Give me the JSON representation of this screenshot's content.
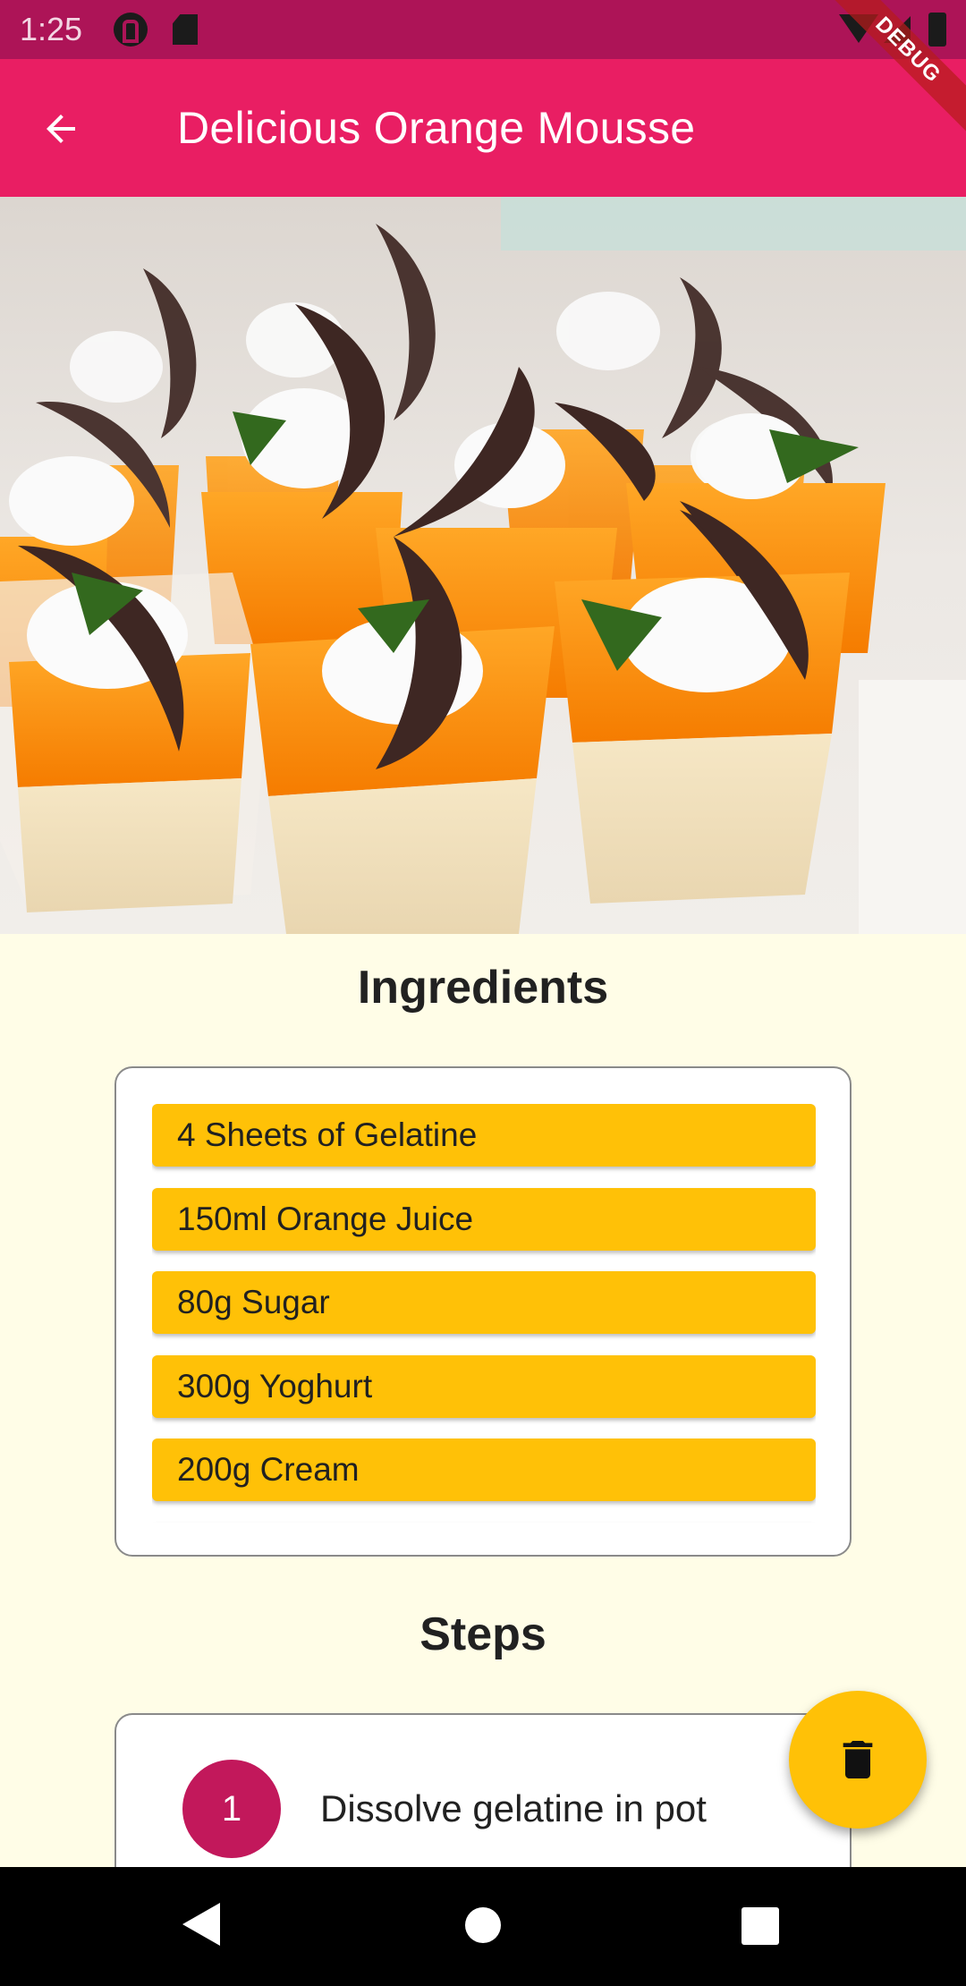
{
  "status_bar": {
    "time": "1:25",
    "icons": [
      "app-notification-icon",
      "sd-card-icon",
      "wifi-icon",
      "signal-icon",
      "battery-icon"
    ]
  },
  "debug_banner": "DEBUG",
  "app_bar": {
    "back_icon": "arrow-back-icon",
    "title": "Delicious Orange Mousse"
  },
  "hero": {
    "icon": "orange-mousse-photo"
  },
  "ingredients": {
    "title": "Ingredients",
    "items": [
      "4 Sheets of Gelatine",
      "150ml Orange Juice",
      "80g Sugar",
      "300g Yoghurt",
      "200g Cream",
      ""
    ]
  },
  "steps": {
    "title": "Steps",
    "items": [
      {
        "number": "1",
        "text": "Dissolve gelatine in pot"
      }
    ]
  },
  "fab": {
    "icon": "delete-icon"
  },
  "nav_bar": {
    "icons": [
      "nav-back-icon",
      "nav-home-icon",
      "nav-recents-icon"
    ]
  },
  "colors": {
    "status_bar": "#AD1457",
    "app_bar": "#E91E63",
    "background": "#FFFDE7",
    "ingredient_chip": "#FFC107",
    "step_badge": "#C2185B",
    "fab": "#FFC107"
  }
}
